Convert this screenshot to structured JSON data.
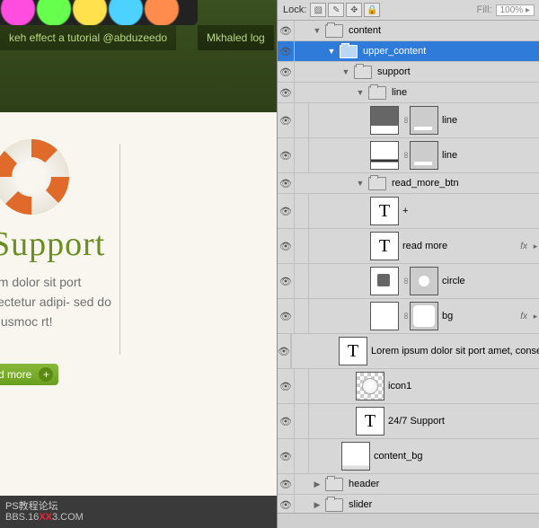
{
  "canvas": {
    "tab1": "keh effect a tutorial @abduzeedo",
    "tab2": "Mkhaled log",
    "support_title": "Support",
    "body_text": "um dolor sit port sectetur adipi- sed do eiusmoc rt!",
    "readmore": "d more",
    "plus": "+",
    "footer1": "PS教程论坛",
    "footer2a": "BBS.16",
    "footer2x": "XX",
    "footer2b": "3.COM"
  },
  "panel": {
    "lock_label": "Lock:",
    "fill_label": "Fill:",
    "fill_value": "100%",
    "layers": {
      "content": "content",
      "upper_content": "upper_content",
      "support": "support",
      "line_group": "line",
      "line1": "line",
      "line2": "line",
      "read_more_btn": "read_more_btn",
      "plus": "+",
      "read_more": "read more",
      "circle": "circle",
      "bg": "bg",
      "lorem": "Lorem ipsum dolor sit port amet, consec.",
      "icon1": "icon1",
      "support_text": "24/7 Support",
      "content_bg": "content_bg",
      "header": "header",
      "slider": "slider"
    },
    "fx": "fx"
  }
}
